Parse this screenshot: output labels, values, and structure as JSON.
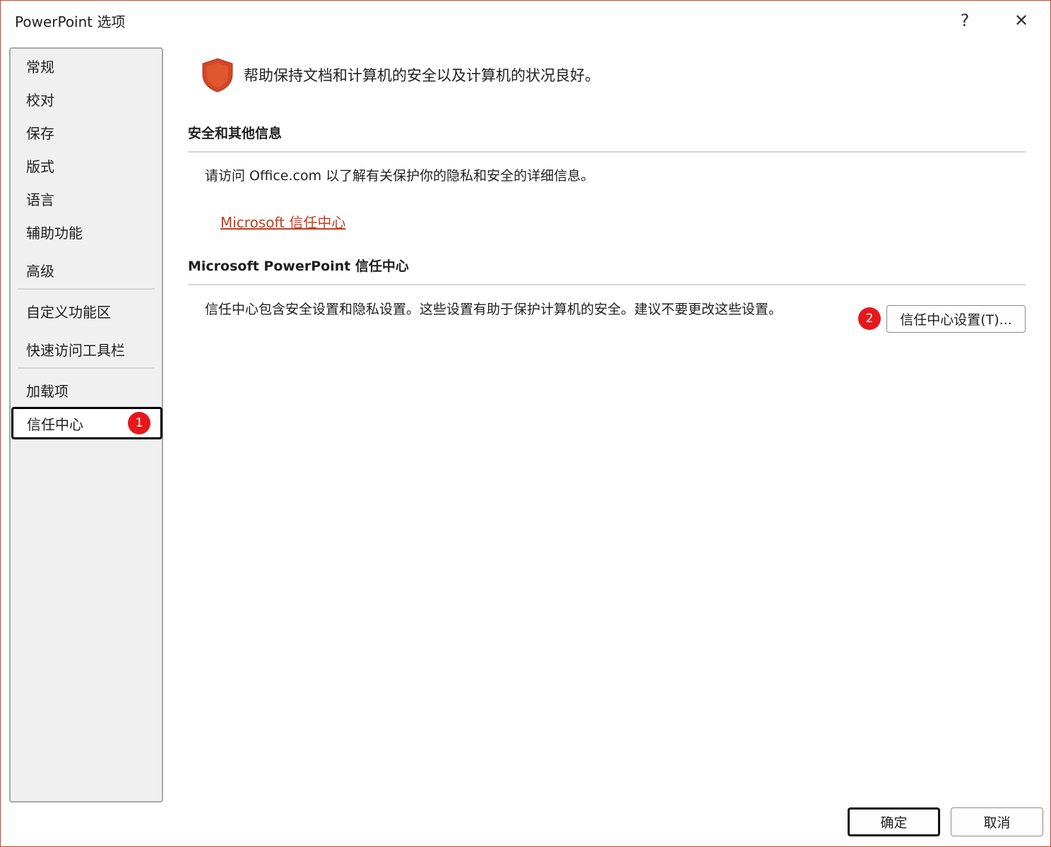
{
  "window": {
    "title": "PowerPoint 选项",
    "help_label": "?",
    "close_label": "✕"
  },
  "sidebar": {
    "items": [
      {
        "label": "常规"
      },
      {
        "label": "校对"
      },
      {
        "label": "保存"
      },
      {
        "label": "版式"
      },
      {
        "label": "语言"
      },
      {
        "label": "辅助功能"
      },
      {
        "label": "高级"
      },
      {
        "label": "自定义功能区"
      },
      {
        "label": "快速访问工具栏"
      },
      {
        "label": "加载项"
      },
      {
        "label": "信任中心",
        "selected": true
      }
    ],
    "selected_badge": "1"
  },
  "main": {
    "headline_icon": "shield-icon",
    "headline": "帮助保持文档和计算机的安全以及计算机的状况良好。",
    "section1": {
      "title": "安全和其他信息",
      "text": "请访问 Office.com  以了解有关保护你的隐私和安全的详细信息。",
      "link": "Microsoft 信任中心"
    },
    "section2": {
      "title": "Microsoft PowerPoint 信任中心",
      "text": "信任中心包含安全设置和隐私设置。这些设置有助于保护计算机的安全。建议不要更改这些设置。",
      "badge": "2",
      "button_label": "信任中心设置(T)..."
    }
  },
  "footer": {
    "ok_label": "确定",
    "cancel_label": "取消"
  },
  "colors": {
    "accent": "#c43e1c",
    "badge": "#e5181b",
    "shield": "#d24726"
  }
}
